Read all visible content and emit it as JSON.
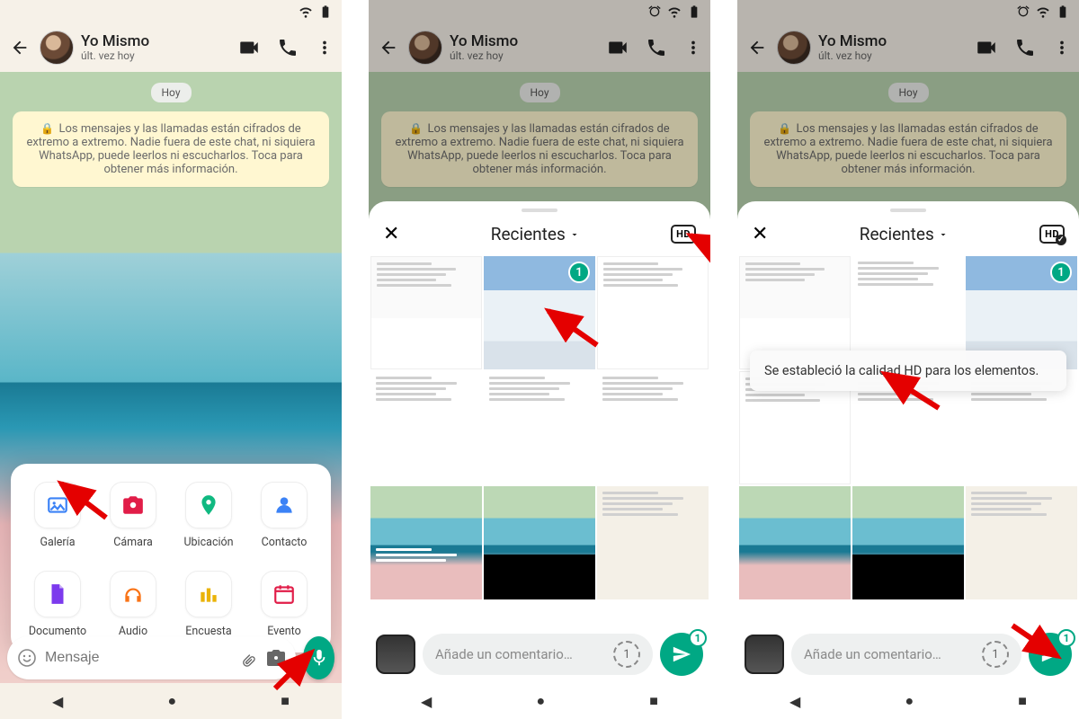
{
  "status_icons": [
    "alarm",
    "wifi",
    "battery"
  ],
  "header": {
    "name": "Yo Mismo",
    "last_seen": "últ. vez hoy"
  },
  "chat": {
    "date": "Hoy",
    "encryption": "Los mensajes y las llamadas están cifrados de extremo a extremo. Nadie fuera de este chat, ni siquiera WhatsApp, puede leerlos ni escucharlos. Toca para obtener más información."
  },
  "input": {
    "placeholder": "Mensaje",
    "comment_placeholder": "Añade un comentario…"
  },
  "attach": {
    "items": [
      {
        "label": "Galería",
        "color": "#3b82f6",
        "icon": "image"
      },
      {
        "label": "Cámara",
        "color": "#e11d48",
        "icon": "camera"
      },
      {
        "label": "Ubicación",
        "color": "#10b981",
        "icon": "pin"
      },
      {
        "label": "Contacto",
        "color": "#3b82f6",
        "icon": "person"
      },
      {
        "label": "Documento",
        "color": "#7c3aed",
        "icon": "doc"
      },
      {
        "label": "Audio",
        "color": "#f97316",
        "icon": "headphones"
      },
      {
        "label": "Encuesta",
        "color": "#eab308",
        "icon": "poll"
      },
      {
        "label": "Evento",
        "color": "#e11d48",
        "icon": "calendar"
      }
    ]
  },
  "picker": {
    "album": "Recientes",
    "hd_label": "HD",
    "selected_count": "1",
    "view_once": "1"
  },
  "toast": "Se estableció la calidad HD para los elementos.",
  "send_count": "1"
}
